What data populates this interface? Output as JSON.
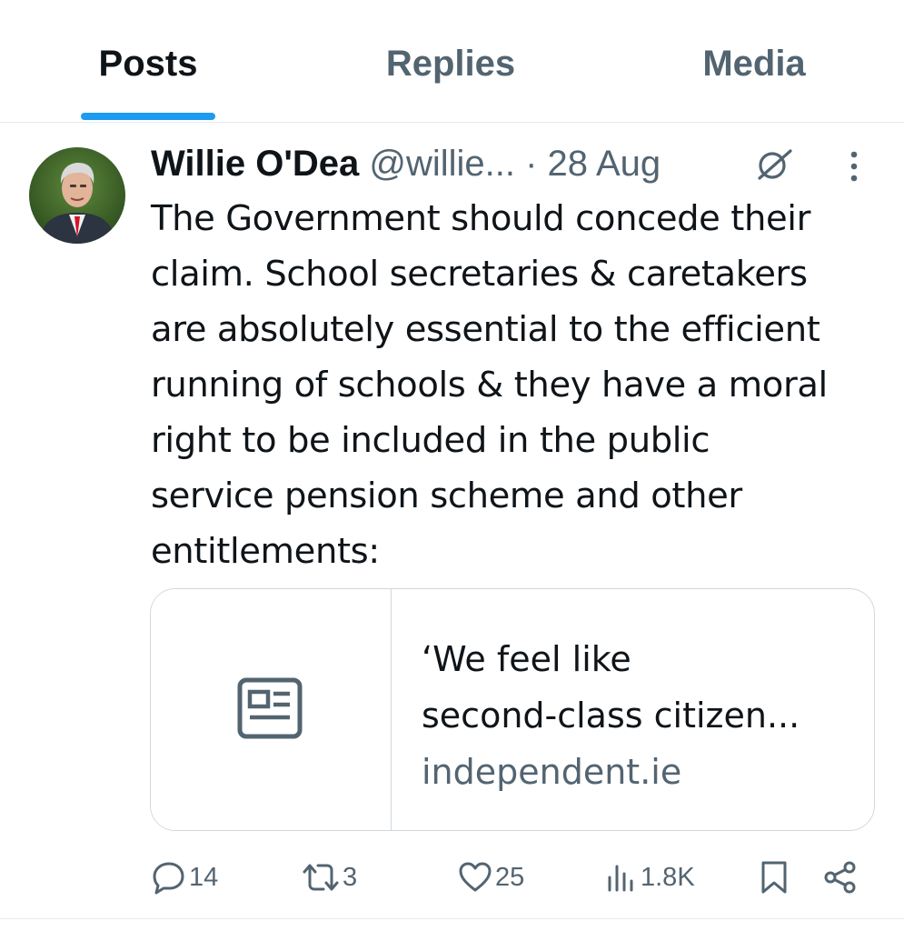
{
  "tabs": [
    {
      "label": "Posts",
      "active": true
    },
    {
      "label": "Replies",
      "active": false
    },
    {
      "label": "Media",
      "active": false
    }
  ],
  "tweet": {
    "author_name": "Willie O'Dea",
    "handle": "@willie...",
    "separator": "·",
    "date": "28 Aug",
    "text_lines": [
      "The Government should concede their",
      "claim. School secretaries & caretakers",
      "are absolutely essential to the efficient",
      "running of schools & they have a moral",
      "right to be included in the public",
      "service pension scheme and other",
      "entitlements:"
    ],
    "card": {
      "title_line1": "‘We feel like",
      "title_line2": "second-class citizen...",
      "domain": "independent.ie",
      "icon": "news-article-icon"
    },
    "metrics": {
      "replies": "14",
      "reposts": "3",
      "likes": "25",
      "views": "1.8K"
    }
  },
  "colors": {
    "accent": "#1d9bf0",
    "text_primary": "#0f1419",
    "text_secondary": "#536471",
    "border": "#cfd9de"
  }
}
